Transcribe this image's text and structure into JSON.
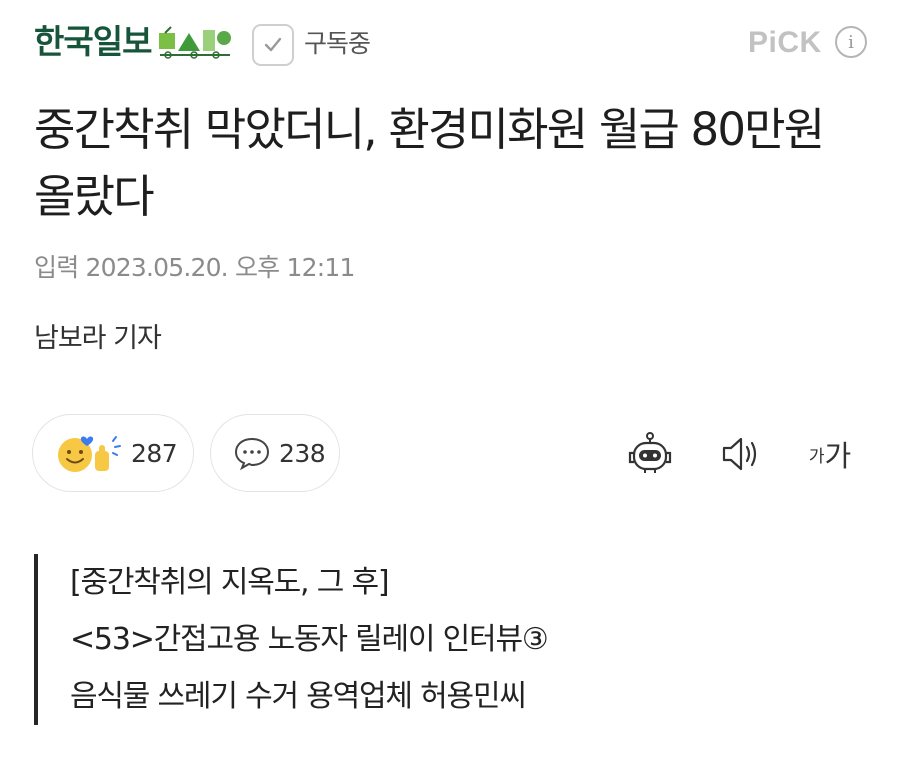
{
  "header": {
    "logo_text": "한국일보",
    "subscribe_label": "구독중",
    "pick_label": "PiCK",
    "info_glyph": "i"
  },
  "article": {
    "title": "중간착취 막았더니, 환경미화원 월급 80만원 올랐다",
    "date": "입력 2023.05.20. 오후 12:11",
    "reporter": "남보라 기자"
  },
  "reactions": {
    "like_count": "287",
    "comment_count": "238"
  },
  "tools": {
    "font_small": "가",
    "font_big": "가",
    "icons": [
      "summary-bot-icon",
      "speaker-icon",
      "font-size-icon"
    ]
  },
  "quote": {
    "lines": [
      "[중간착취의 지옥도, 그 후]",
      "<53>간접고용 노동자 릴레이 인터뷰③",
      "음식물 쓰레기 수거 용역업체 허용민씨"
    ]
  },
  "colors": {
    "brand_green": "#16553a",
    "muted_gray": "#8b8b8b",
    "emoji_yellow": "#f7c843",
    "heart_blue": "#3b7cf0"
  }
}
